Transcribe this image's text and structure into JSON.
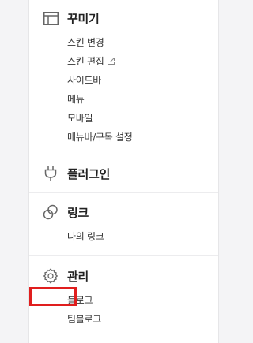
{
  "sections": [
    {
      "title": "꾸미기",
      "icon": "layout-icon",
      "items": [
        {
          "label": "스킨 변경"
        },
        {
          "label": "스킨 편집",
          "external": true
        },
        {
          "label": "사이드바"
        },
        {
          "label": "메뉴"
        },
        {
          "label": "모바일"
        },
        {
          "label": "메뉴바/구독 설정"
        }
      ]
    },
    {
      "title": "플러그인",
      "icon": "plug-icon",
      "items": []
    },
    {
      "title": "링크",
      "icon": "link-icon",
      "items": [
        {
          "label": "나의 링크"
        }
      ]
    },
    {
      "title": "관리",
      "icon": "gear-icon",
      "items": [
        {
          "label": "블로그",
          "highlighted": true
        },
        {
          "label": "팀블로그"
        }
      ]
    }
  ],
  "highlight_color": "#e01e1e"
}
